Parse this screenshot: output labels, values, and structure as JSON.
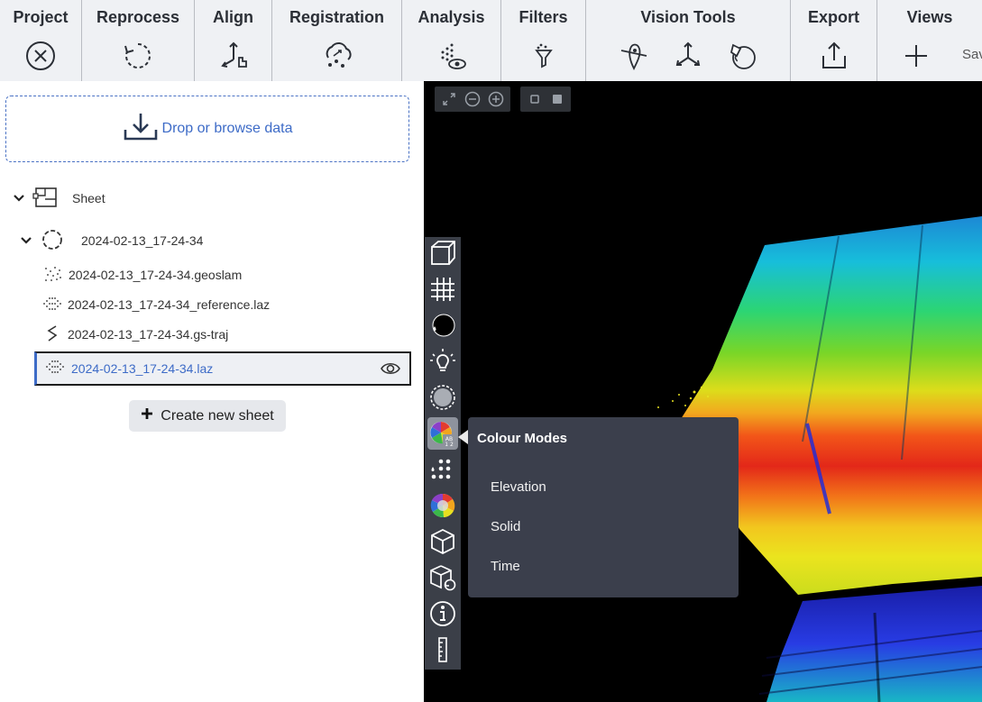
{
  "toolbar": {
    "groups": [
      {
        "label": "Project"
      },
      {
        "label": "Reprocess"
      },
      {
        "label": "Align"
      },
      {
        "label": "Registration"
      },
      {
        "label": "Analysis"
      },
      {
        "label": "Filters"
      },
      {
        "label": "Vision Tools"
      },
      {
        "label": "Export"
      },
      {
        "label": "Views"
      }
    ],
    "save_truncated": "Sav"
  },
  "dropzone": {
    "label": "Drop or browse data"
  },
  "tree": {
    "sheet_label": "Sheet",
    "dataset_label": "2024-02-13_17-24-34",
    "files": [
      {
        "label": "2024-02-13_17-24-34.geoslam",
        "icon": "geoslam-icon"
      },
      {
        "label": "2024-02-13_17-24-34_reference.laz",
        "icon": "pointcloud-icon"
      },
      {
        "label": "2024-02-13_17-24-34.gs-traj",
        "icon": "trajectory-icon"
      },
      {
        "label": "2024-02-13_17-24-34.laz",
        "icon": "pointcloud-icon",
        "selected": true
      }
    ]
  },
  "create_sheet": {
    "label": "Create new sheet"
  },
  "colour_modes": {
    "title": "Colour Modes",
    "items": [
      "Elevation",
      "Solid",
      "Time"
    ]
  },
  "colors": {
    "accent": "#3d6bc7",
    "toolbar_bg": "#eff1f4",
    "sidebar_bg": "#3b3f48",
    "popover_bg": "#3b3f4c"
  }
}
